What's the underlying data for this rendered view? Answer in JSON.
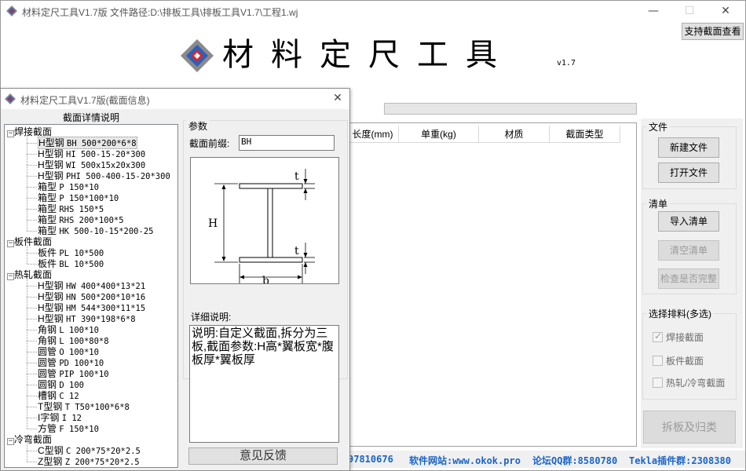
{
  "main_window": {
    "title": "材料定尺工具V1.7版  文件路径:D:\\排板工具\\排板工具V1.7\\工程1.wj",
    "minimize_glyph": "—",
    "maximize_glyph": "☐",
    "close_glyph": "✕",
    "support_button": "支持截面查看",
    "banner_title": "材料定尺工具",
    "banner_version": "v1.7",
    "table_columns": [
      "长度(mm)",
      "单重(kg)",
      "材质",
      "截面类型"
    ],
    "file_group": {
      "label": "文件",
      "new_file": "新建文件",
      "open_file": "打开文件"
    },
    "list_group": {
      "label": "清单",
      "import": "导入清单",
      "clear": "清空清单",
      "check": "检查是否完整"
    },
    "select_group": {
      "label": "选择排料(多选)",
      "options": [
        {
          "label": "焊接截面",
          "checked": true
        },
        {
          "label": "板件截面",
          "checked": false
        },
        {
          "label": "热轧/冷弯截面",
          "checked": false
        }
      ]
    },
    "split_button": "拆板及归类",
    "status": {
      "qq_fragment": "97810676",
      "website": "软件网站:www.okok.pro",
      "forum_qq": "论坛QQ群:8580780",
      "tekla_group": "Tekla插件群:2308380"
    }
  },
  "dialog": {
    "title": "材料定尺工具V1.7版(截面信息)",
    "close_glyph": "✕",
    "tree_header": "截面详情说明",
    "tree": [
      {
        "category": "焊接截面",
        "expanded": true,
        "items": [
          {
            "kind": "H型钢",
            "spec": "BH 500*200*6*8",
            "selected": true
          },
          {
            "kind": "H型钢",
            "spec": "HI 500-15-20*300"
          },
          {
            "kind": "H型钢",
            "spec": "WI 500x15x20x300"
          },
          {
            "kind": "H型钢",
            "spec": "PHI 500-400-15-20*300"
          },
          {
            "kind": "箱型",
            "spec": "P 150*10"
          },
          {
            "kind": "箱型",
            "spec": "P 150*100*10"
          },
          {
            "kind": "箱型",
            "spec": "RHS 150*5"
          },
          {
            "kind": "箱型",
            "spec": "RHS 200*100*5"
          },
          {
            "kind": "箱型",
            "spec": "HK 500-10-15*200-25"
          }
        ]
      },
      {
        "category": "板件截面",
        "expanded": true,
        "items": [
          {
            "kind": "板件",
            "spec": "PL 10*500"
          },
          {
            "kind": "板件",
            "spec": "BL 10*500"
          }
        ]
      },
      {
        "category": "热轧截面",
        "expanded": true,
        "items": [
          {
            "kind": "H型钢",
            "spec": "HW 400*400*13*21"
          },
          {
            "kind": "H型钢",
            "spec": "HN 500*200*10*16"
          },
          {
            "kind": "H型钢",
            "spec": "HM 544*300*11*15"
          },
          {
            "kind": "H型钢",
            "spec": "HT 390*198*6*8"
          },
          {
            "kind": "角钢",
            "spec": "L 100*10"
          },
          {
            "kind": "角钢",
            "spec": "L 100*80*8"
          },
          {
            "kind": "圆管",
            "spec": "O 100*10"
          },
          {
            "kind": "圆管",
            "spec": "PD 100*10"
          },
          {
            "kind": "圆管",
            "spec": "PIP 100*10"
          },
          {
            "kind": "圆钢",
            "spec": "D 100"
          },
          {
            "kind": "槽钢",
            "spec": "C 12"
          },
          {
            "kind": "T型钢",
            "spec": "T T50*100*6*8"
          },
          {
            "kind": "I字钢",
            "spec": "I 12"
          },
          {
            "kind": "方管",
            "spec": "F 150*10"
          }
        ]
      },
      {
        "category": "冷弯截面",
        "expanded": true,
        "items": [
          {
            "kind": "C型钢",
            "spec": "C 200*75*20*2.5"
          },
          {
            "kind": "Z型钢",
            "spec": "Z 200*75*20*2.5"
          }
        ]
      }
    ],
    "params": {
      "group_label": "参数",
      "prefix_label": "截面前缀:",
      "prefix_value": "BH",
      "diagram_labels": {
        "h": "H",
        "b": "b",
        "t_top": "t",
        "t_bottom": "t"
      },
      "detail_label": "详细说明:",
      "detail_text": "说明:自定义截面,拆分为三板,截面参数:H高*翼板宽*腹板厚*翼板厚",
      "feedback_button": "意见反馈"
    }
  },
  "colors": {
    "status_text": "#1a64c8",
    "logo_red": "#d42a2a",
    "logo_blue": "#2a5fc0",
    "logo_gray": "#8a8a8a"
  },
  "icons": [
    "app-logo-icon",
    "minimize-icon",
    "maximize-icon",
    "close-icon",
    "checkbox-icon",
    "tree-expander-icon"
  ]
}
